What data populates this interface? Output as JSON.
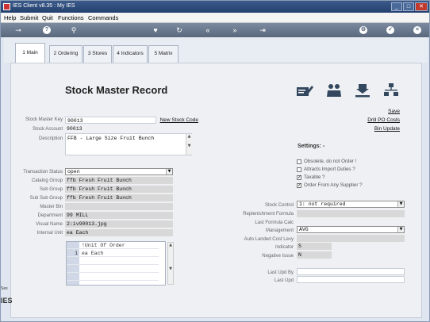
{
  "window": {
    "title": "IES Client v8.35 : My IES"
  },
  "menu": [
    "Help",
    "Submit",
    "Quit",
    "Functions",
    "Commands"
  ],
  "toolbar": {
    "icons": [
      "key-icon",
      "help-icon",
      "search-icon",
      "heart-icon",
      "refresh-icon",
      "rewind-icon",
      "fast-forward-icon",
      "skip-forward-icon",
      "settings-icon",
      "check-icon",
      "close-icon"
    ],
    "glyphs": [
      "⊸",
      "?",
      "⚲",
      "♥",
      "↻",
      "«",
      "»",
      "⇥",
      "⚙",
      "✓",
      "×"
    ]
  },
  "tabs": [
    {
      "label": "1 Main",
      "active": true
    },
    {
      "label": "2 Ordering",
      "active": false
    },
    {
      "label": "3 Stores",
      "active": false
    },
    {
      "label": "4 Indicators",
      "active": false
    },
    {
      "label": "5 Matrix",
      "active": false
    }
  ],
  "page": {
    "title": "Stock Master Record"
  },
  "actions": {
    "save": "Save",
    "drill_po_costs": "Drill PO Costs",
    "bin_update": "Bin Update",
    "new_stock_code": "New Stock Code"
  },
  "left_fields": {
    "stock_master_key": {
      "label": "Stock Master Key",
      "value": "90013"
    },
    "stock_account": {
      "label": "Stock Account",
      "value": "90013"
    },
    "description": {
      "label": "Description",
      "value": "FFB - Large Size Fruit Bunch"
    },
    "transaction_status": {
      "label": "Transaction Status",
      "value": "open"
    },
    "catalog_group": {
      "label": "Catalog Group",
      "value": "ffb Fresh Fruit Bunch"
    },
    "sub_group": {
      "label": "Sub Group",
      "value": "ffb Fresh Fruit Bunch"
    },
    "sub_sub_group": {
      "label": "Sub Sub Group",
      "value": "ffb Fresh Fruit Bunch"
    },
    "master_bin": {
      "label": "Master Bin",
      "value": ""
    },
    "department": {
      "label": "Department",
      "value": "99 MILL"
    },
    "visual_name": {
      "label": "Visual Name",
      "value": "2:iv90013.jpg"
    },
    "internal_unit": {
      "label": "Internal Unit",
      "value": "ea Each"
    }
  },
  "unit_grid": {
    "header": "!Unit Of Order",
    "rows": [
      {
        "idx": "1",
        "value": "ea Each"
      }
    ]
  },
  "settings": {
    "title": "Settings: -",
    "checks": [
      {
        "label": "Obsolete, do not Order !",
        "checked": false
      },
      {
        "label": "Attracts Import Duties ?",
        "checked": false
      },
      {
        "label": "Taxable ?",
        "checked": true
      },
      {
        "label": "Order From Any Supplier ?",
        "checked": true
      }
    ]
  },
  "right_fields": {
    "stock_control": {
      "label": "Stock Control",
      "value": "1: not required"
    },
    "replenishment_formula": {
      "label": "Replenishment Formula",
      "value": ""
    },
    "last_formula_calc": {
      "label": "Last Formula Calc",
      "value": ""
    },
    "management": {
      "label": "Management",
      "value": "AVG"
    },
    "auto_landed_cost_levy": {
      "label": "Auto Landed Cost Levy",
      "value": ""
    },
    "indicator": {
      "label": "Indicator",
      "value": "S"
    },
    "negative_issue": {
      "label": "Negative Issue",
      "value": "N"
    },
    "last_upd_by": {
      "label": "Last Upd By",
      "value": ""
    },
    "last_upd": {
      "label": "Last Upd",
      "value": ""
    }
  },
  "side": {
    "small": "Ses",
    "big": "IES"
  }
}
